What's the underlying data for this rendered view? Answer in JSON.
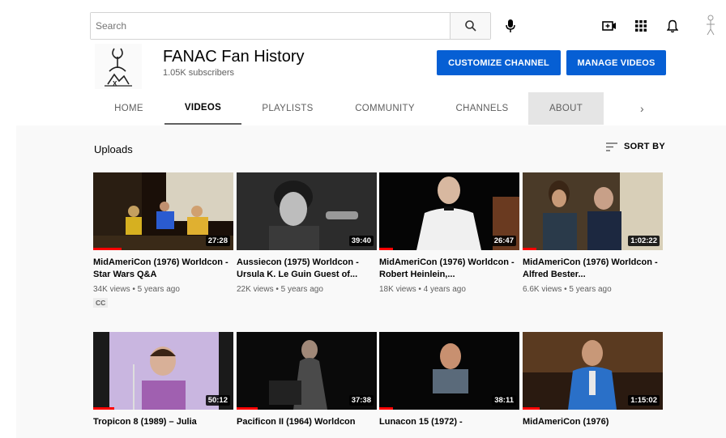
{
  "search": {
    "placeholder": "Search"
  },
  "header_icons": [
    "search-icon",
    "mic-icon",
    "create-video-icon",
    "apps-grid-icon",
    "notifications-bell-icon"
  ],
  "channel": {
    "name": "FANAC Fan History",
    "subscribers": "1.05K subscribers",
    "customize_label": "CUSTOMIZE CHANNEL",
    "manage_label": "MANAGE VIDEOS"
  },
  "tabs": [
    {
      "label": "HOME"
    },
    {
      "label": "VIDEOS"
    },
    {
      "label": "PLAYLISTS"
    },
    {
      "label": "COMMUNITY"
    },
    {
      "label": "CHANNELS"
    },
    {
      "label": "ABOUT"
    }
  ],
  "tabs_more": "›",
  "section": {
    "title": "Uploads",
    "sort_label": "SORT BY"
  },
  "colors": {
    "accent": "#065fd4",
    "progress": "#ff0000",
    "text_secondary": "#606060"
  },
  "videos": [
    {
      "title": "MidAmeriCon (1976) Worldcon - Star Wars Q&A",
      "duration": "27:28",
      "views": "34K views",
      "age": "5 years ago",
      "badge": "CC",
      "progress": 0.2
    },
    {
      "title": "Aussiecon (1975) Worldcon - Ursula K. Le Guin Guest of...",
      "duration": "39:40",
      "views": "22K views",
      "age": "5 years ago",
      "badge": "",
      "progress": 0.0
    },
    {
      "title": "MidAmeriCon (1976) Worldcon - Robert Heinlein,...",
      "duration": "26:47",
      "views": "18K views",
      "age": "4 years ago",
      "badge": "",
      "progress": 0.1
    },
    {
      "title": "MidAmeriCon (1976) Worldcon - Alfred Bester...",
      "duration": "1:02:22",
      "views": "6.6K views",
      "age": "5 years ago",
      "badge": "",
      "progress": 0.1
    },
    {
      "title": "Tropicon 8 (1989) – Julia",
      "duration": "50:12",
      "views": "",
      "age": "",
      "badge": "",
      "progress": 0.15
    },
    {
      "title": "Pacificon II (1964) Worldcon",
      "duration": "37:38",
      "views": "",
      "age": "",
      "badge": "",
      "progress": 0.15
    },
    {
      "title": "Lunacon 15 (1972) -",
      "duration": "38:11",
      "views": "",
      "age": "",
      "badge": "",
      "progress": 0.1
    },
    {
      "title": "MidAmeriCon (1976)",
      "duration": "1:15:02",
      "views": "",
      "age": "",
      "badge": "",
      "progress": 0.12
    }
  ]
}
